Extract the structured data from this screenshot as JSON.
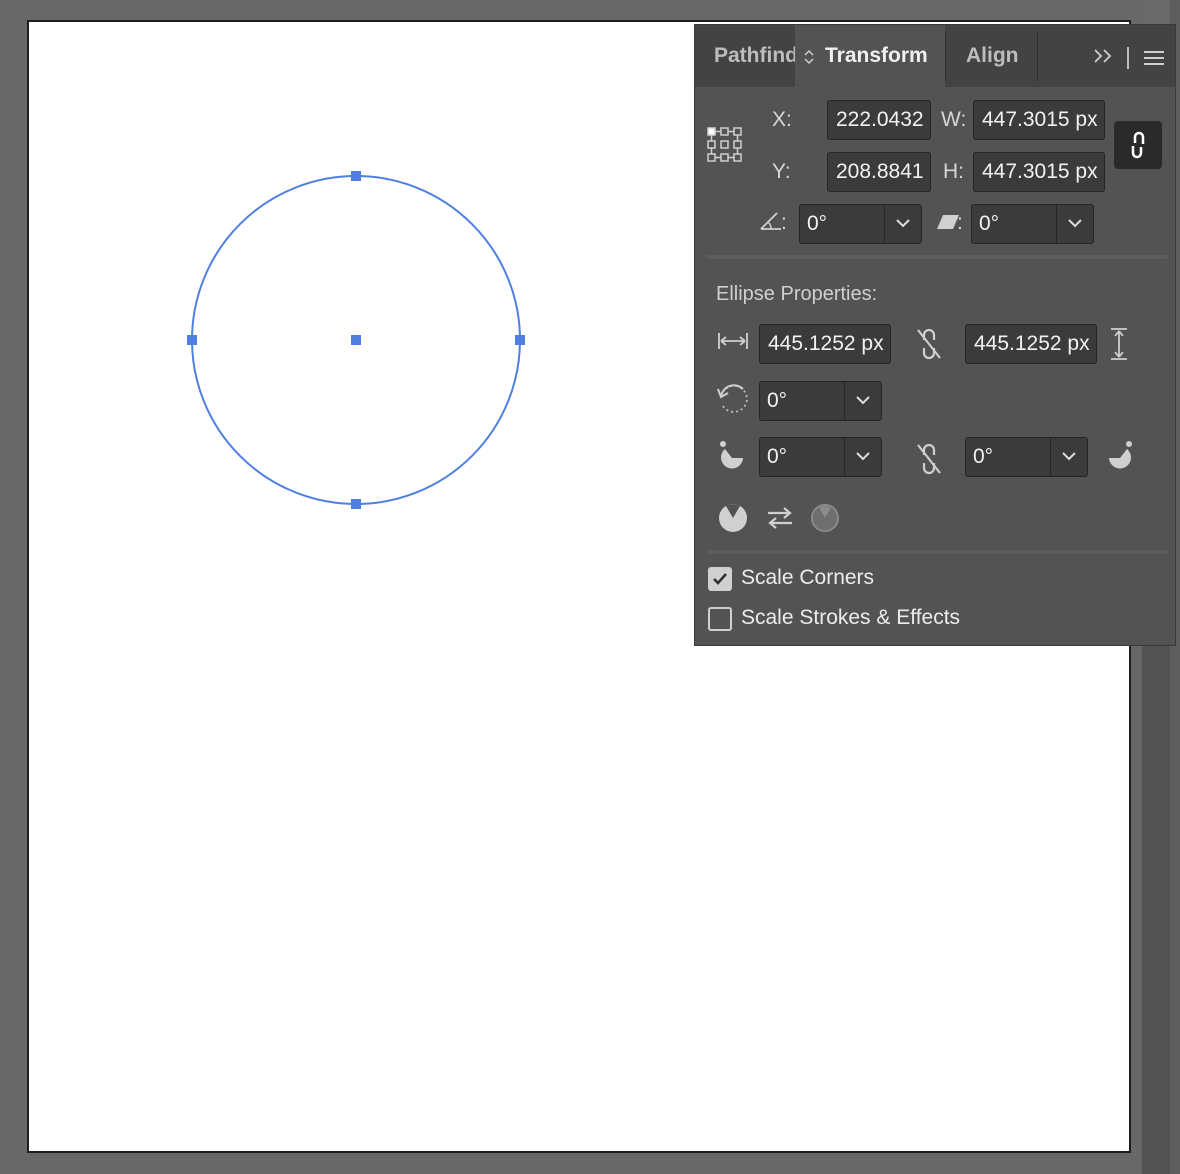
{
  "tabs": {
    "pathfinder": "Pathfinder",
    "transform": "Transform",
    "align": "Align"
  },
  "transform": {
    "x_label": "X:",
    "x_value": "222.0432 px",
    "y_label": "Y:",
    "y_value": "208.8841 px",
    "w_label": "W:",
    "w_value": "447.3015 px",
    "h_label": "H:",
    "h_value": "447.3015 px",
    "angle_value": "0°",
    "shear_value": "0°",
    "colon": ":"
  },
  "ellipse": {
    "heading": "Ellipse Properties:",
    "width_value": "445.1252 px",
    "height_value": "445.1252 px",
    "rotation_value": "0°",
    "pie_start_value": "0°",
    "pie_end_value": "0°"
  },
  "options": {
    "scale_corners_label": "Scale Corners",
    "scale_corners_checked": true,
    "scale_strokes_label": "Scale Strokes & Effects",
    "scale_strokes_checked": false
  },
  "colors": {
    "selection": "#4f80e0",
    "panel_bg": "#535353",
    "tab_bar_bg": "#434343",
    "field_bg": "#3b3b3b"
  },
  "icons": [
    "reference-point-icon",
    "constrain-link-icon",
    "rotate-icon",
    "shear-icon",
    "width-arrows-icon",
    "height-arrows-icon",
    "broken-link-icon",
    "ellipse-rotate-icon",
    "pie-start-icon",
    "pie-end-icon",
    "pie-invert-icon",
    "swap-icon",
    "pie-toggle-icon",
    "overflow-chevrons-icon",
    "panel-menu-icon"
  ]
}
